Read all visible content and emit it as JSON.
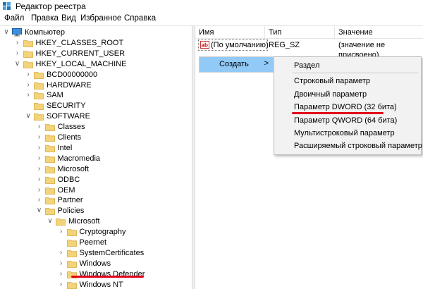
{
  "window": {
    "title": "Редактор реестра"
  },
  "menubar": [
    "Файл",
    "Правка",
    "Вид",
    "Избранное",
    "Справка"
  ],
  "tree": [
    {
      "label": "Компьютер",
      "exp": "v",
      "icon": "computer-icon",
      "level": 0
    },
    {
      "label": "HKEY_CLASSES_ROOT",
      "exp": ">",
      "level": 1
    },
    {
      "label": "HKEY_CURRENT_USER",
      "exp": ">",
      "level": 1
    },
    {
      "label": "HKEY_LOCAL_MACHINE",
      "exp": "v",
      "level": 1
    },
    {
      "label": "BCD00000000",
      "exp": ">",
      "level": 2
    },
    {
      "label": "HARDWARE",
      "exp": ">",
      "level": 2
    },
    {
      "label": "SAM",
      "exp": ">",
      "level": 2
    },
    {
      "label": "SECURITY",
      "exp": "",
      "level": 2
    },
    {
      "label": "SOFTWARE",
      "exp": "v",
      "level": 2
    },
    {
      "label": "Classes",
      "exp": ">",
      "level": 3
    },
    {
      "label": "Clients",
      "exp": ">",
      "level": 3
    },
    {
      "label": "Intel",
      "exp": ">",
      "level": 3
    },
    {
      "label": "Macromedia",
      "exp": ">",
      "level": 3
    },
    {
      "label": "Microsoft",
      "exp": ">",
      "level": 3
    },
    {
      "label": "ODBC",
      "exp": ">",
      "level": 3
    },
    {
      "label": "OEM",
      "exp": ">",
      "level": 3
    },
    {
      "label": "Partner",
      "exp": ">",
      "level": 3
    },
    {
      "label": "Policies",
      "exp": "v",
      "level": 3
    },
    {
      "label": "Microsoft",
      "exp": "v",
      "level": 4
    },
    {
      "label": "Cryptography",
      "exp": ">",
      "level": 5
    },
    {
      "label": "Peernet",
      "exp": "",
      "level": 5
    },
    {
      "label": "SystemCertificates",
      "exp": ">",
      "level": 5
    },
    {
      "label": "Windows",
      "exp": ">",
      "level": 5
    },
    {
      "label": "Windows Defender",
      "exp": ">",
      "level": 5,
      "highlighted": true
    },
    {
      "label": "Windows NT",
      "exp": ">",
      "level": 5
    }
  ],
  "values_pane": {
    "columns": [
      "Имя",
      "Тип",
      "Значение"
    ],
    "rows": [
      {
        "name": "(По умолчанию)",
        "type": "REG_SZ",
        "value": "(значение не присвоено)"
      }
    ]
  },
  "context_menu": {
    "item": "Создать",
    "arrow": ">"
  },
  "submenu": {
    "items": [
      "Раздел",
      "Строковый параметр",
      "Двоичный параметр",
      "Параметр DWORD (32 бита)",
      "Параметр QWORD (64 бита)",
      "Мультистроковый параметр",
      "Расширяемый строковый параметр"
    ],
    "highlighted_index": 3
  },
  "colors": {
    "accent": "#91c9f7",
    "annotation": "#e2001a",
    "folder": "#f3d47b"
  }
}
